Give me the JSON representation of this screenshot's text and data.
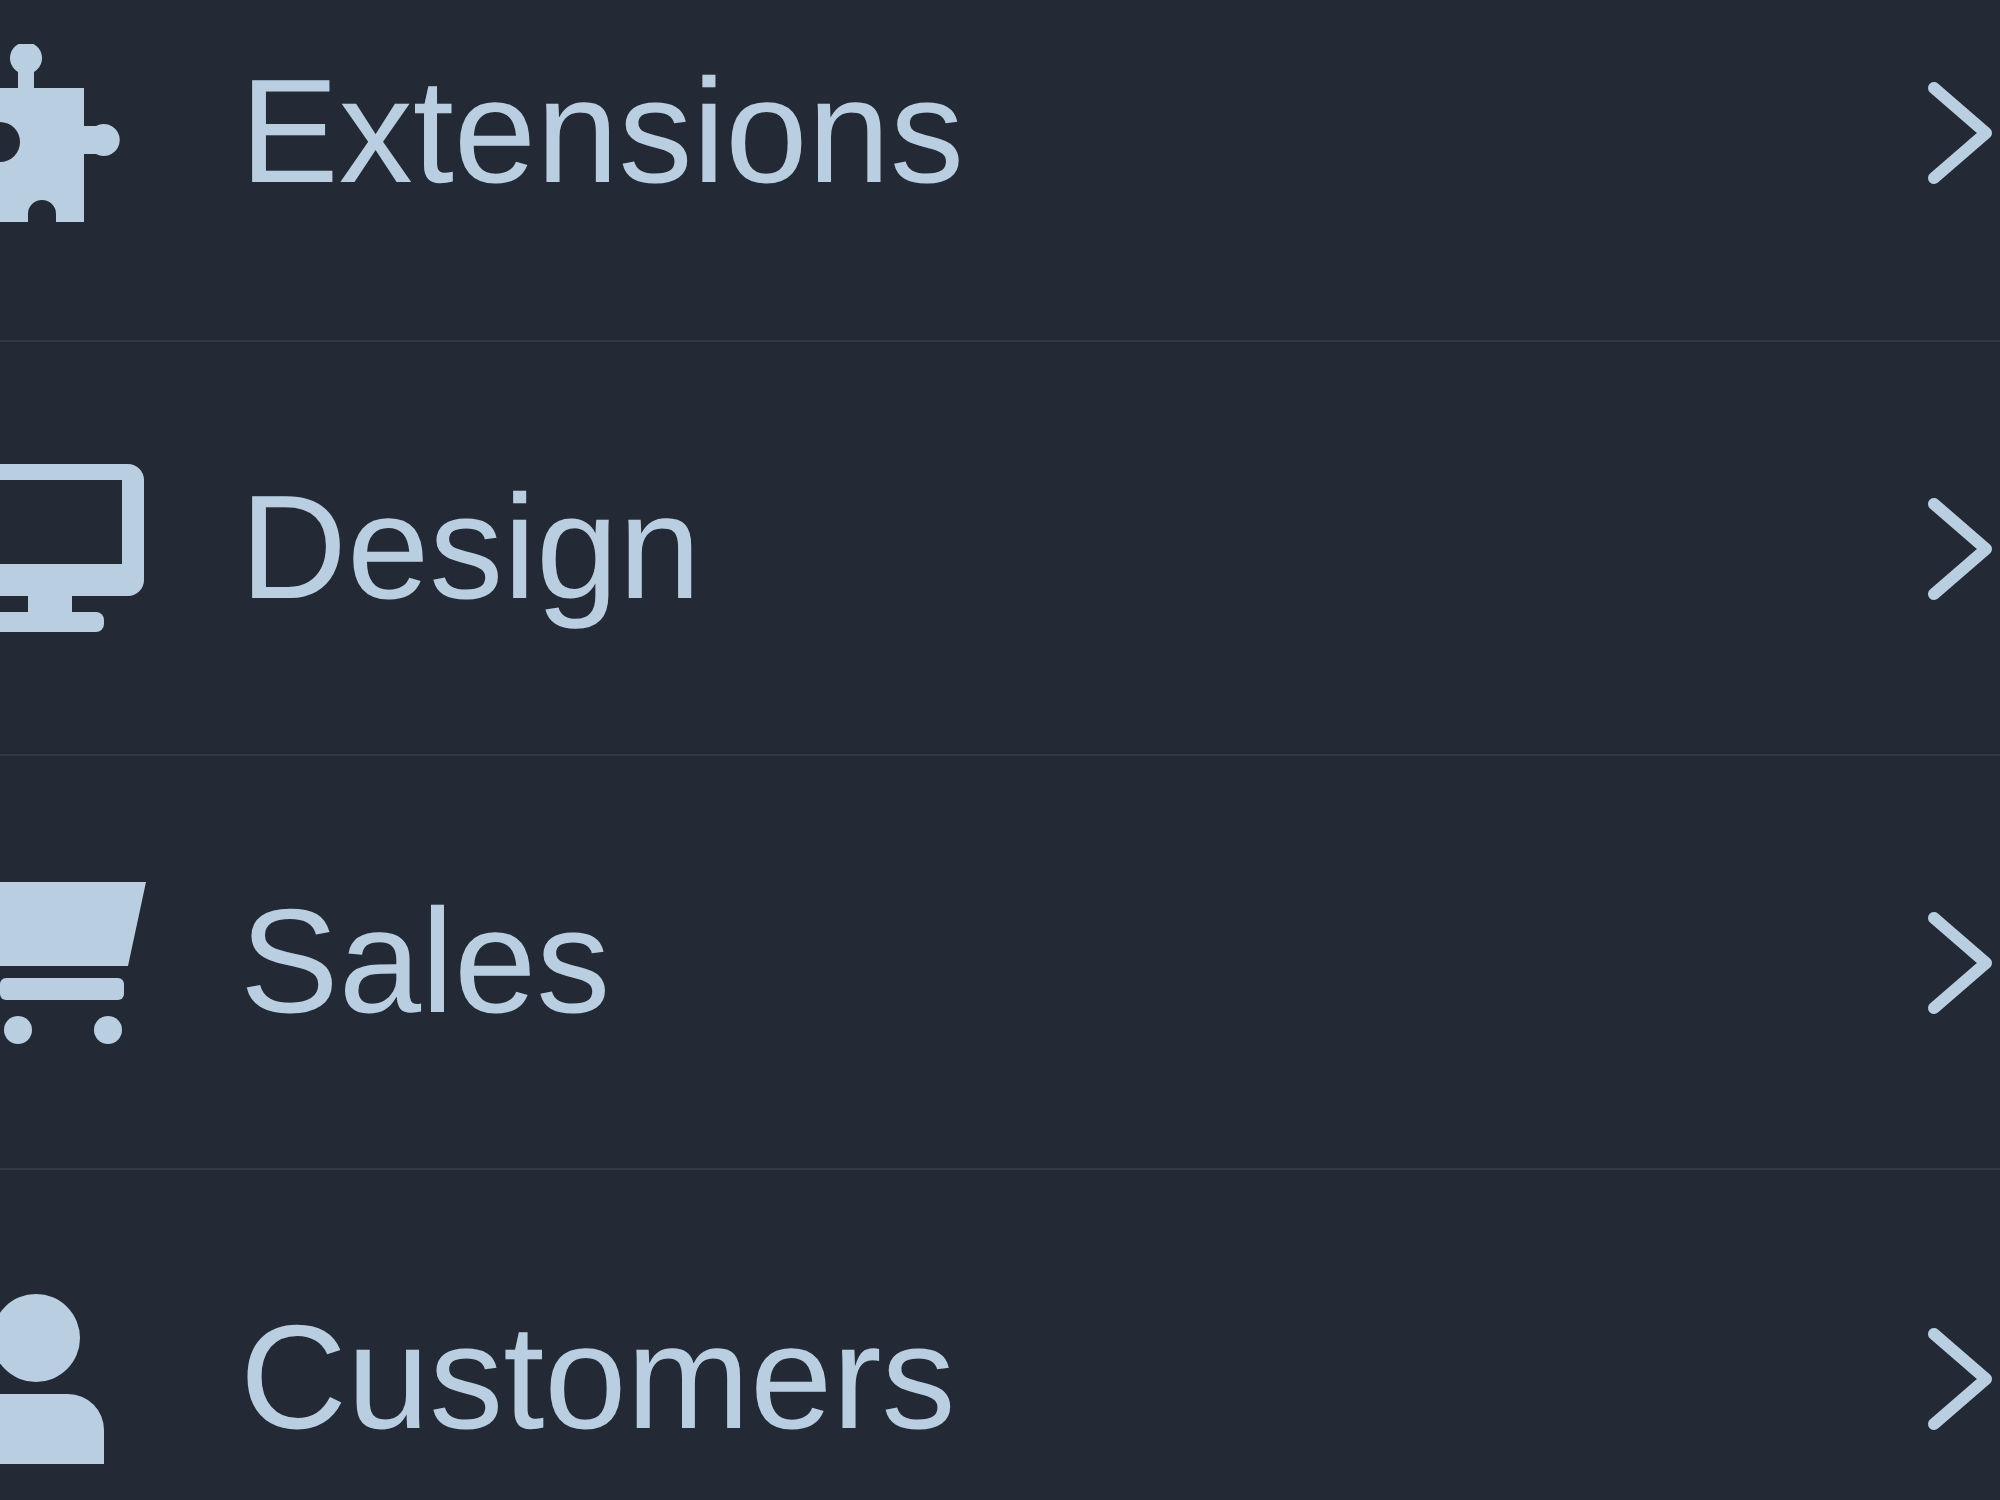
{
  "menu": {
    "items": [
      {
        "label": "Extensions",
        "expanded": false
      },
      {
        "label": "Design",
        "expanded": false
      },
      {
        "label": "Sales",
        "expanded": false
      },
      {
        "label": "Customers",
        "expanded": false
      }
    ]
  }
}
